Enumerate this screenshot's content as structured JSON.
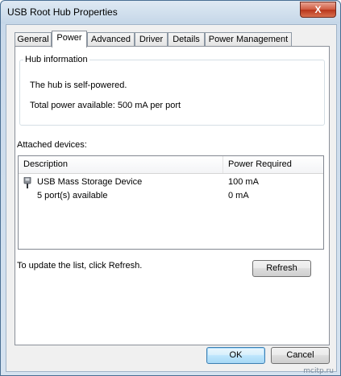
{
  "window": {
    "title": "USB Root Hub Properties",
    "close_glyph": "X"
  },
  "tabs": [
    {
      "label": "General"
    },
    {
      "label": "Power"
    },
    {
      "label": "Advanced"
    },
    {
      "label": "Driver"
    },
    {
      "label": "Details"
    },
    {
      "label": "Power Management"
    }
  ],
  "active_tab": "Power",
  "hub_info": {
    "legend": "Hub information",
    "self_powered": "The hub is self-powered.",
    "total_power": "Total power available:  500 mA per port"
  },
  "attached": {
    "label": "Attached devices:",
    "columns": [
      "Description",
      "Power Required"
    ],
    "rows": [
      {
        "icon": "usb-plug-icon",
        "description": "USB Mass Storage Device",
        "power": "100 mA"
      },
      {
        "icon": "",
        "description": "5 port(s) available",
        "power": "0 mA"
      }
    ]
  },
  "refresh_hint": "To update the list, click Refresh.",
  "buttons": {
    "refresh": "Refresh",
    "ok": "OK",
    "cancel": "Cancel"
  },
  "watermark": "mcitp.ru"
}
